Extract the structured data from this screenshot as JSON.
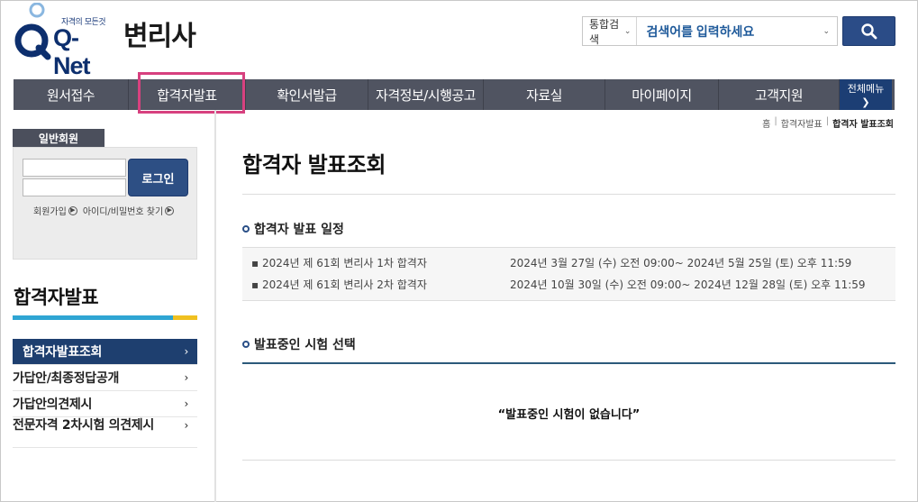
{
  "header": {
    "logo_tagline": "자격의 모든것",
    "logo_text": "Q-Net",
    "site_title": "변리사",
    "search": {
      "category": "통합검색",
      "placeholder": "검색어를 입력하세요"
    }
  },
  "nav": {
    "items": [
      {
        "label": "원서접수"
      },
      {
        "label": "합격자발표"
      },
      {
        "label": "확인서발급"
      },
      {
        "label": "자격정보/시행공고"
      },
      {
        "label": "자료실"
      },
      {
        "label": "마이페이지"
      },
      {
        "label": "고객지원"
      }
    ],
    "all_menu": "전체메뉴"
  },
  "login": {
    "tab": "일반회원",
    "button": "로그인",
    "join": "회원가입",
    "find": "아이디/비밀번호 찾기"
  },
  "sidebar": {
    "title": "합격자발표",
    "items": [
      {
        "label": "합격자발표조회"
      },
      {
        "label": "가답안/최종정답공개"
      },
      {
        "label": "가답안의견제시"
      },
      {
        "label": "전문자격 2차시험 의견제시"
      }
    ]
  },
  "breadcrumb": {
    "home": "홈",
    "level1": "합격자발표",
    "current": "합격자 발표조회"
  },
  "main": {
    "title": "합격자 발표조회",
    "schedule_title": "합격자 발표 일정",
    "schedule": [
      {
        "name": "2024년 제 61회 변리사 1차 합격자",
        "period": "2024년 3월 27일 (수) 오전 09:00~ 2024년 5월 25일 (토) 오후 11:59"
      },
      {
        "name": "2024년 제 61회 변리사 2차 합격자",
        "period": "2024년 10월 30일 (수) 오전 09:00~ 2024년 12월 28일 (토) 오후 11:59"
      }
    ],
    "select_title": "발표중인 시험 선택",
    "empty_message": "“발표중인 시험이 없습니다”"
  },
  "colors": {
    "nav_bg": "#505461",
    "accent_blue": "#2b4c87",
    "highlight": "#d7417f",
    "side_active": "#1e3f6f"
  }
}
